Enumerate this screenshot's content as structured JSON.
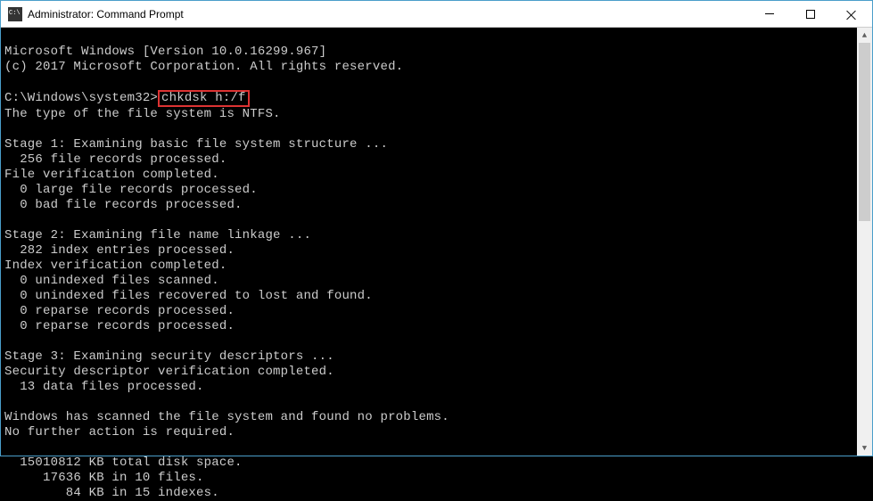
{
  "window": {
    "title": "Administrator: Command Prompt"
  },
  "prompt": {
    "path": "C:\\Windows\\system32>",
    "command": "chkdsk h:/f"
  },
  "lines": {
    "l0": "Microsoft Windows [Version 10.0.16299.967]",
    "l1": "(c) 2017 Microsoft Corporation. All rights reserved.",
    "l2": "",
    "l3_after": "",
    "l4": "The type of the file system is NTFS.",
    "l5": "",
    "l6": "Stage 1: Examining basic file system structure ...",
    "l7": "  256 file records processed.",
    "l8": "File verification completed.",
    "l9": "  0 large file records processed.",
    "l10": "  0 bad file records processed.",
    "l11": "",
    "l12": "Stage 2: Examining file name linkage ...",
    "l13": "  282 index entries processed.",
    "l14": "Index verification completed.",
    "l15": "  0 unindexed files scanned.",
    "l16": "  0 unindexed files recovered to lost and found.",
    "l17": "  0 reparse records processed.",
    "l18": "  0 reparse records processed.",
    "l19": "",
    "l20": "Stage 3: Examining security descriptors ...",
    "l21": "Security descriptor verification completed.",
    "l22": "  13 data files processed.",
    "l23": "",
    "l24": "Windows has scanned the file system and found no problems.",
    "l25": "No further action is required.",
    "l26": "",
    "l27": "  15010812 KB total disk space.",
    "l28": "     17636 KB in 10 files.",
    "l29": "        84 KB in 15 indexes."
  }
}
